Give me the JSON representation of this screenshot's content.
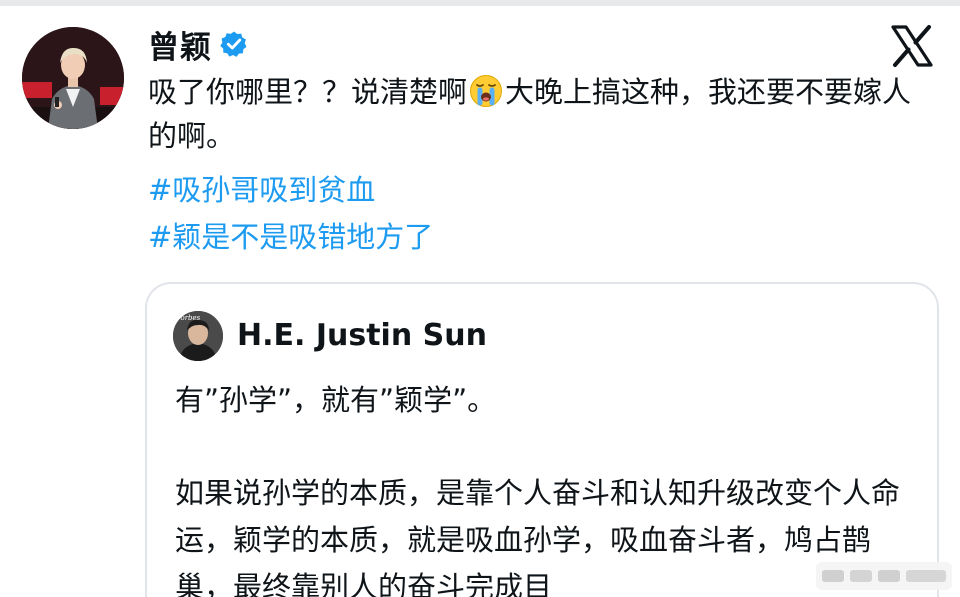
{
  "tweet": {
    "author_name": "曾颖",
    "verified_icon": "verified-badge-icon",
    "platform_icon": "x-logo-icon",
    "text_before_emoji": "吸了你哪里？？说清楚啊",
    "emoji": "loudly-crying-face-emoji",
    "text_after_emoji": "大晚上搞这种，我还要不要嫁人的啊。",
    "hashtags": [
      "#吸孙哥吸到贫血",
      "#颖是不是吸错地方了"
    ],
    "colors": {
      "hashtag": "#1d9bf0",
      "verified": "#1d9bf0",
      "text": "#0f1419"
    }
  },
  "quoted_tweet": {
    "author_name": "H.E. Justin Sun",
    "avatar_badge": "Forbes",
    "line1": "有”孙学”，就有”颖学”。",
    "paragraph2": "如果说孙学的本质，是靠个人奋斗和认知升级改变个人命运，颖学的本质，就是吸血孙学，吸血奋斗者，鸠占鹊巢，最终靠别人的奋斗完成目"
  }
}
